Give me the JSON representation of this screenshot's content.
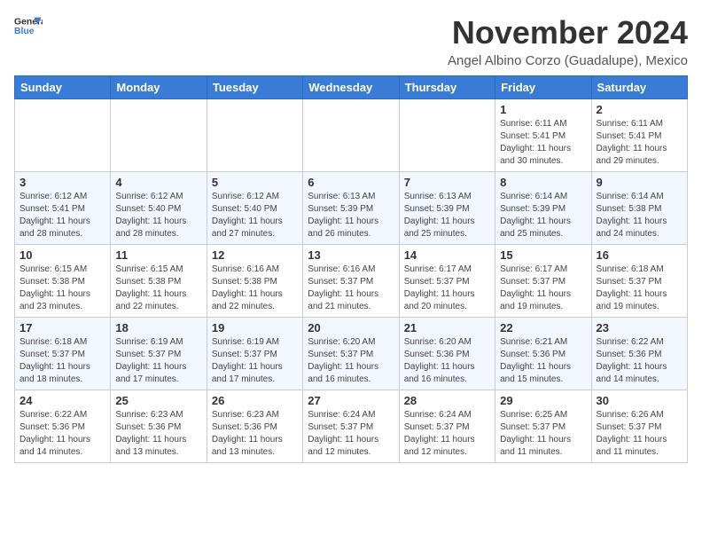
{
  "logo": {
    "line1": "General",
    "line2": "Blue"
  },
  "title": "November 2024",
  "location": "Angel Albino Corzo (Guadalupe), Mexico",
  "weekdays": [
    "Sunday",
    "Monday",
    "Tuesday",
    "Wednesday",
    "Thursday",
    "Friday",
    "Saturday"
  ],
  "weeks": [
    [
      {
        "day": "",
        "info": ""
      },
      {
        "day": "",
        "info": ""
      },
      {
        "day": "",
        "info": ""
      },
      {
        "day": "",
        "info": ""
      },
      {
        "day": "",
        "info": ""
      },
      {
        "day": "1",
        "info": "Sunrise: 6:11 AM\nSunset: 5:41 PM\nDaylight: 11 hours and 30 minutes."
      },
      {
        "day": "2",
        "info": "Sunrise: 6:11 AM\nSunset: 5:41 PM\nDaylight: 11 hours and 29 minutes."
      }
    ],
    [
      {
        "day": "3",
        "info": "Sunrise: 6:12 AM\nSunset: 5:41 PM\nDaylight: 11 hours and 28 minutes."
      },
      {
        "day": "4",
        "info": "Sunrise: 6:12 AM\nSunset: 5:40 PM\nDaylight: 11 hours and 28 minutes."
      },
      {
        "day": "5",
        "info": "Sunrise: 6:12 AM\nSunset: 5:40 PM\nDaylight: 11 hours and 27 minutes."
      },
      {
        "day": "6",
        "info": "Sunrise: 6:13 AM\nSunset: 5:39 PM\nDaylight: 11 hours and 26 minutes."
      },
      {
        "day": "7",
        "info": "Sunrise: 6:13 AM\nSunset: 5:39 PM\nDaylight: 11 hours and 25 minutes."
      },
      {
        "day": "8",
        "info": "Sunrise: 6:14 AM\nSunset: 5:39 PM\nDaylight: 11 hours and 25 minutes."
      },
      {
        "day": "9",
        "info": "Sunrise: 6:14 AM\nSunset: 5:38 PM\nDaylight: 11 hours and 24 minutes."
      }
    ],
    [
      {
        "day": "10",
        "info": "Sunrise: 6:15 AM\nSunset: 5:38 PM\nDaylight: 11 hours and 23 minutes."
      },
      {
        "day": "11",
        "info": "Sunrise: 6:15 AM\nSunset: 5:38 PM\nDaylight: 11 hours and 22 minutes."
      },
      {
        "day": "12",
        "info": "Sunrise: 6:16 AM\nSunset: 5:38 PM\nDaylight: 11 hours and 22 minutes."
      },
      {
        "day": "13",
        "info": "Sunrise: 6:16 AM\nSunset: 5:37 PM\nDaylight: 11 hours and 21 minutes."
      },
      {
        "day": "14",
        "info": "Sunrise: 6:17 AM\nSunset: 5:37 PM\nDaylight: 11 hours and 20 minutes."
      },
      {
        "day": "15",
        "info": "Sunrise: 6:17 AM\nSunset: 5:37 PM\nDaylight: 11 hours and 19 minutes."
      },
      {
        "day": "16",
        "info": "Sunrise: 6:18 AM\nSunset: 5:37 PM\nDaylight: 11 hours and 19 minutes."
      }
    ],
    [
      {
        "day": "17",
        "info": "Sunrise: 6:18 AM\nSunset: 5:37 PM\nDaylight: 11 hours and 18 minutes."
      },
      {
        "day": "18",
        "info": "Sunrise: 6:19 AM\nSunset: 5:37 PM\nDaylight: 11 hours and 17 minutes."
      },
      {
        "day": "19",
        "info": "Sunrise: 6:19 AM\nSunset: 5:37 PM\nDaylight: 11 hours and 17 minutes."
      },
      {
        "day": "20",
        "info": "Sunrise: 6:20 AM\nSunset: 5:37 PM\nDaylight: 11 hours and 16 minutes."
      },
      {
        "day": "21",
        "info": "Sunrise: 6:20 AM\nSunset: 5:36 PM\nDaylight: 11 hours and 16 minutes."
      },
      {
        "day": "22",
        "info": "Sunrise: 6:21 AM\nSunset: 5:36 PM\nDaylight: 11 hours and 15 minutes."
      },
      {
        "day": "23",
        "info": "Sunrise: 6:22 AM\nSunset: 5:36 PM\nDaylight: 11 hours and 14 minutes."
      }
    ],
    [
      {
        "day": "24",
        "info": "Sunrise: 6:22 AM\nSunset: 5:36 PM\nDaylight: 11 hours and 14 minutes."
      },
      {
        "day": "25",
        "info": "Sunrise: 6:23 AM\nSunset: 5:36 PM\nDaylight: 11 hours and 13 minutes."
      },
      {
        "day": "26",
        "info": "Sunrise: 6:23 AM\nSunset: 5:36 PM\nDaylight: 11 hours and 13 minutes."
      },
      {
        "day": "27",
        "info": "Sunrise: 6:24 AM\nSunset: 5:37 PM\nDaylight: 11 hours and 12 minutes."
      },
      {
        "day": "28",
        "info": "Sunrise: 6:24 AM\nSunset: 5:37 PM\nDaylight: 11 hours and 12 minutes."
      },
      {
        "day": "29",
        "info": "Sunrise: 6:25 AM\nSunset: 5:37 PM\nDaylight: 11 hours and 11 minutes."
      },
      {
        "day": "30",
        "info": "Sunrise: 6:26 AM\nSunset: 5:37 PM\nDaylight: 11 hours and 11 minutes."
      }
    ]
  ]
}
